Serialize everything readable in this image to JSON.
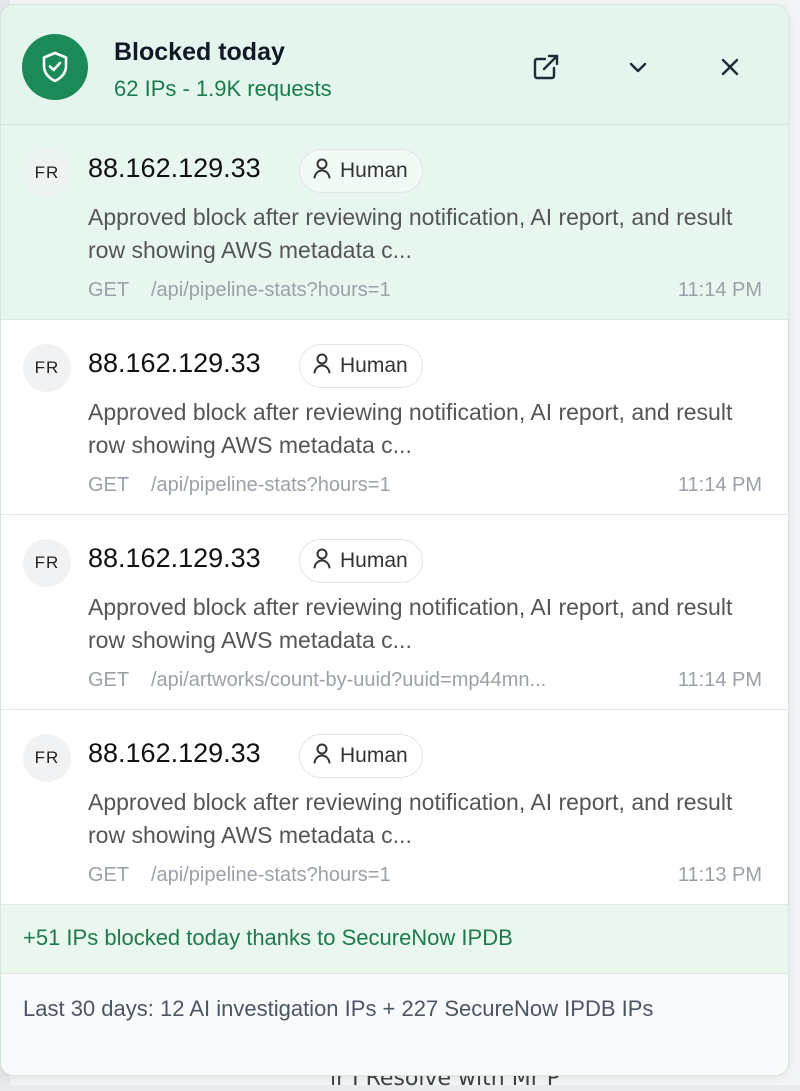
{
  "background": {
    "partial_text": "ir I Resolve with Mr P"
  },
  "header": {
    "title": "Blocked today",
    "subtitle": "62 IPs - 1.9K requests",
    "icons": {
      "shield": "shield-icon",
      "open": "external-link-icon",
      "collapse": "chevron-down-icon",
      "close": "close-icon"
    }
  },
  "entries": [
    {
      "country": "FR",
      "ip": "88.162.129.33",
      "badge": "Human",
      "description": "Approved block after reviewing notification, AI report, and result row showing AWS metadata c...",
      "method": "GET",
      "path": "/api/pipeline-stats?hours=1",
      "time": "11:14 PM"
    },
    {
      "country": "FR",
      "ip": "88.162.129.33",
      "badge": "Human",
      "description": "Approved block after reviewing notification, AI report, and result row showing AWS metadata c...",
      "method": "GET",
      "path": "/api/pipeline-stats?hours=1",
      "time": "11:14 PM"
    },
    {
      "country": "FR",
      "ip": "88.162.129.33",
      "badge": "Human",
      "description": "Approved block after reviewing notification, AI report, and result row showing AWS metadata c...",
      "method": "GET",
      "path": "/api/artworks/count-by-uuid?uuid=mp44mn...",
      "time": "11:14 PM"
    },
    {
      "country": "FR",
      "ip": "88.162.129.33",
      "badge": "Human",
      "description": "Approved block after reviewing notification, AI report, and result row showing AWS metadata c...",
      "method": "GET",
      "path": "/api/pipeline-stats?hours=1",
      "time": "11:13 PM"
    }
  ],
  "extra_note": "+51 IPs blocked today thanks to SecureNow IPDB",
  "footer_note": "Last 30 days: 12 AI investigation IPs + 227 SecureNow IPDB IPs",
  "colors": {
    "accent": "#1b8a58",
    "header_bg": "#e3f5ec",
    "accent_text": "#1c7a4d"
  }
}
